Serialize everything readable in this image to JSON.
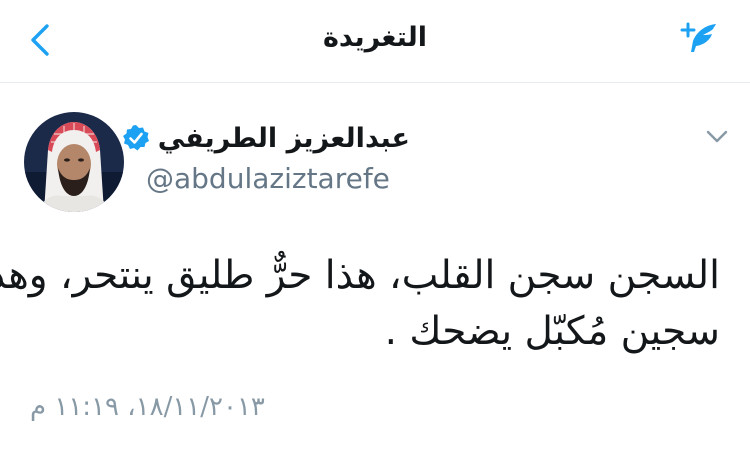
{
  "nav": {
    "title": "التغريدة",
    "back_icon": "chevron-left-icon",
    "compose_icon": "compose-tweet-icon"
  },
  "tweet": {
    "author": {
      "display_name": "عبدالعزيز الطريفي",
      "handle": "@abdulaziztarefe",
      "verified": true,
      "avatar_icon": "avatar"
    },
    "text_lines": [
      "السجن سجن القلب، هذا حرٌّ طليق ينتحر، وهذا",
      "سجين مُكبّل يضحك ."
    ],
    "timestamp": "١٨/١١/٢٠١٣، ١١:١٩ م"
  },
  "colors": {
    "accent": "#1da1f2",
    "text_primary": "#14171a",
    "text_secondary": "#657786",
    "timestamp": "#8899a6",
    "divider": "#e6ecf0"
  }
}
